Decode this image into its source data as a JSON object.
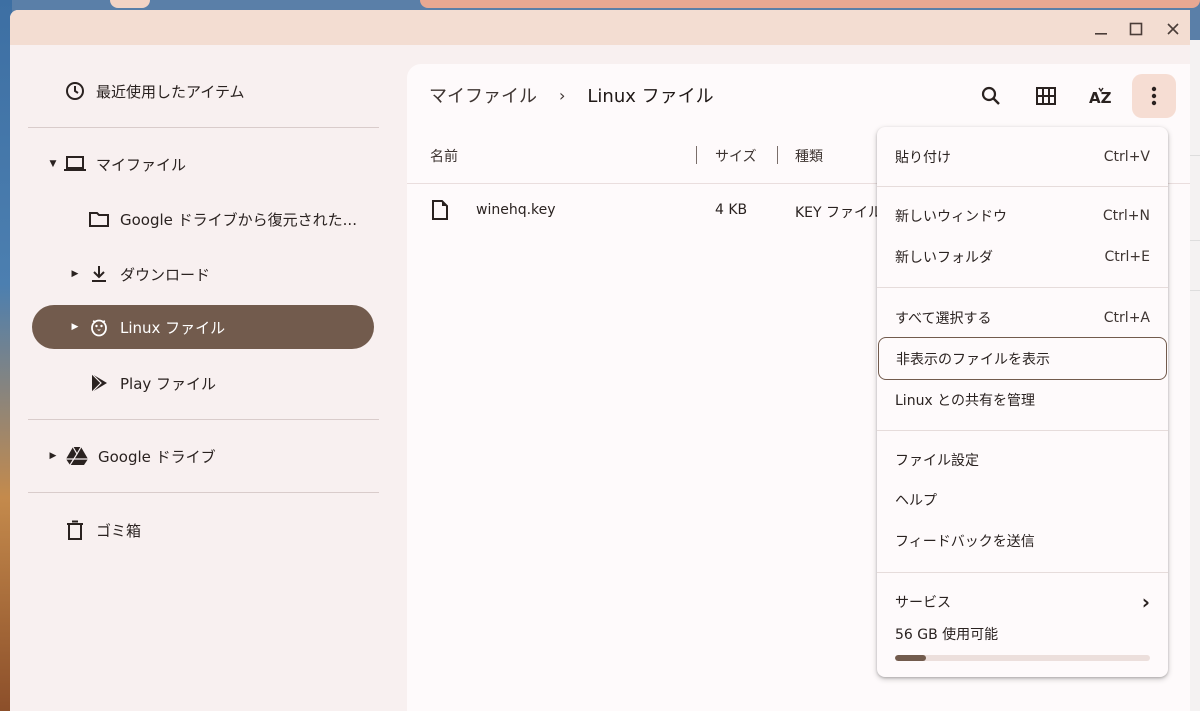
{
  "window": {
    "controls": {
      "minimize": "—",
      "maximize": "☐",
      "close": "✕"
    }
  },
  "sidebar": {
    "recent": "最近使用したアイテム",
    "my_files": "マイファイル",
    "google_restored": "Google ドライブから復元された...",
    "downloads": "ダウンロード",
    "linux_files": "Linux ファイル",
    "play_files": "Play ファイル",
    "google_drive": "Google ドライブ",
    "trash": "ゴミ箱"
  },
  "breadcrumb": {
    "root": "マイファイル",
    "separator": "›",
    "current": "Linux ファイル"
  },
  "table": {
    "columns": {
      "name": "名前",
      "size": "サイズ",
      "type": "種類"
    },
    "rows": [
      {
        "name": "winehq.key",
        "size": "4 KB",
        "type": "KEY ファイル"
      }
    ]
  },
  "menu": {
    "paste": {
      "label": "貼り付け",
      "shortcut": "Ctrl+V"
    },
    "new_window": {
      "label": "新しいウィンドウ",
      "shortcut": "Ctrl+N"
    },
    "new_folder": {
      "label": "新しいフォルダ",
      "shortcut": "Ctrl+E"
    },
    "select_all": {
      "label": "すべて選択する",
      "shortcut": "Ctrl+A"
    },
    "show_hidden": {
      "label": "非表示のファイルを表示"
    },
    "manage_linux_sharing": {
      "label": "Linux との共有を管理"
    },
    "file_settings": {
      "label": "ファイル設定"
    },
    "help": {
      "label": "ヘルプ"
    },
    "send_feedback": {
      "label": "フィードバックを送信"
    },
    "services": {
      "label": "サービス",
      "arrow": "›"
    },
    "storage": {
      "label": "56 GB 使用可能",
      "used_fraction": 0.12
    }
  },
  "colors": {
    "accent": "#725b4d",
    "titlebar": "#f3ddd2",
    "active_button": "#f6ddd3"
  }
}
